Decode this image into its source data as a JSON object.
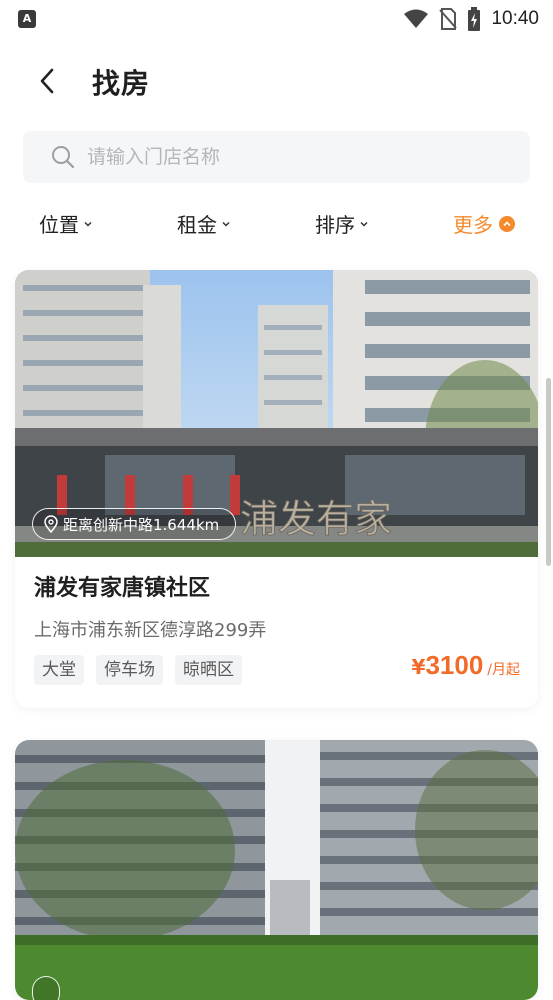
{
  "status_bar": {
    "app_badge": "A",
    "time": "10:40"
  },
  "header": {
    "title": "找房"
  },
  "search": {
    "placeholder": "请输入门店名称"
  },
  "filters": {
    "location": "位置",
    "rent": "租金",
    "sort": "排序",
    "more": "更多"
  },
  "listings": [
    {
      "distance": "距离创新中路1.644km",
      "name": "浦发有家唐镇社区",
      "address": "上海市浦东新区德淳路299弄",
      "tags": [
        "大堂",
        "停车场",
        "晾晒区"
      ],
      "price_currency": "¥",
      "price": "3100",
      "price_unit": "/月起",
      "sign_text": "浦发有家"
    },
    {
      "distance": ""
    }
  ],
  "colors": {
    "accent": "#f48a2c",
    "price": "#f26b2a",
    "search_bg": "#f5f6f8",
    "tag_bg": "#f2f3f5"
  }
}
